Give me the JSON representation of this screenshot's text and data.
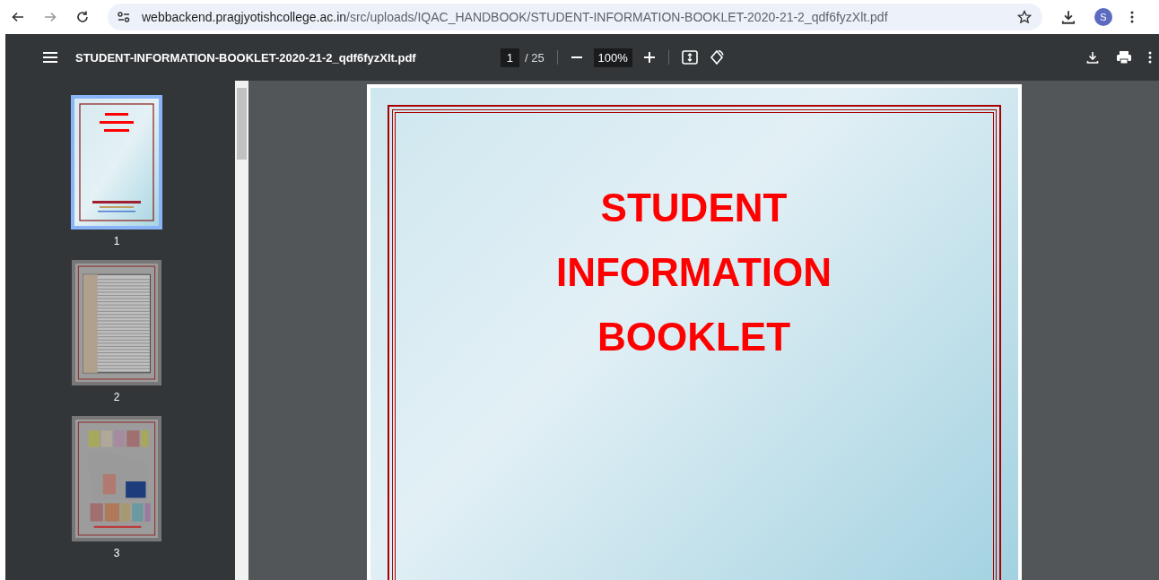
{
  "browser": {
    "url_host": "webbackend.pragjyotishcollege.ac.in",
    "url_path": "/src/uploads/IQAC_HANDBOOK/STUDENT-INFORMATION-BOOKLET-2020-21-2_qdf6fyzXlt.pdf",
    "profile_initial": "S"
  },
  "toolbar": {
    "filename": "STUDENT-INFORMATION-BOOKLET-2020-21-2_qdf6fyzXlt.pdf",
    "page": "1",
    "page_total": "/ 25",
    "zoom": "100%"
  },
  "thumbnails": [
    {
      "label": "1",
      "kind": "cover",
      "selected": true
    },
    {
      "label": "2",
      "kind": "table",
      "selected": false
    },
    {
      "label": "3",
      "kind": "map",
      "selected": false
    }
  ],
  "page": {
    "title_lines": [
      "STUDENT",
      "INFORMATION",
      "BOOKLET"
    ]
  }
}
